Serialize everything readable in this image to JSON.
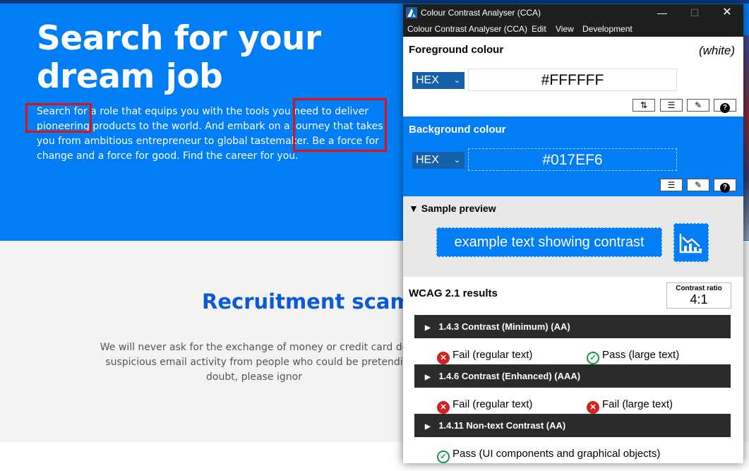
{
  "webpage": {
    "hero": {
      "title_lines": [
        "Search for your",
        "dream job"
      ],
      "paragraph_lines": [
        "Search for a role that equips you with the tools you need to deliver",
        "pioneering products to the world. And embark on a journey that takes",
        "you from ambitious entrepreneur to global tastemaker. Be a force for",
        "change and a force for good. Find the career for you."
      ]
    },
    "scams": {
      "title": "Recruitment scams",
      "lines": [
        "We will never ask for the exchange of money or credit card de",
        "suspicious email activity from people who could be pretendi",
        "doubt, please ignor"
      ]
    }
  },
  "cca": {
    "title": "Colour Contrast Analyser (CCA)",
    "window_buttons": {
      "minimize": "—",
      "maximize": "☐",
      "close": "✕"
    },
    "menu": [
      "Colour Contrast Analyser (CCA)",
      "Edit",
      "View",
      "Development"
    ],
    "foreground": {
      "title": "Foreground colour",
      "name": "(white)",
      "format": "HEX",
      "value": "#FFFFFF"
    },
    "background": {
      "title": "Background colour",
      "format": "HEX",
      "value": "#017EF6"
    },
    "tool_glyphs": {
      "swap": "⇅",
      "sliders": "☰",
      "picker": "✎",
      "help": "?"
    },
    "preview": {
      "title": "Sample preview",
      "sample_text": "example text showing contrast"
    },
    "results": {
      "title": "WCAG 2.1 results",
      "ratio_label": "Contrast ratio",
      "ratio_value": "4:1",
      "criteria": [
        {
          "label": "1.4.3 Contrast (Minimum) (AA)",
          "items": [
            {
              "status": "fail",
              "text": "Fail (regular text)"
            },
            {
              "status": "pass",
              "text": "Pass (large text)"
            }
          ]
        },
        {
          "label": "1.4.6 Contrast (Enhanced) (AAA)",
          "items": [
            {
              "status": "fail",
              "text": "Fail (regular text)"
            },
            {
              "status": "fail",
              "text": "Fail (large text)"
            }
          ]
        },
        {
          "label": "1.4.11 Non-text Contrast (AA)",
          "items": [
            {
              "status": "pass",
              "text": "Pass (UI components and graphical objects)"
            }
          ]
        }
      ]
    },
    "colors": {
      "background_sample": "#017EF6",
      "fail": "#d32222",
      "pass": "#119944",
      "titlebar": "#1f1f1f"
    }
  }
}
